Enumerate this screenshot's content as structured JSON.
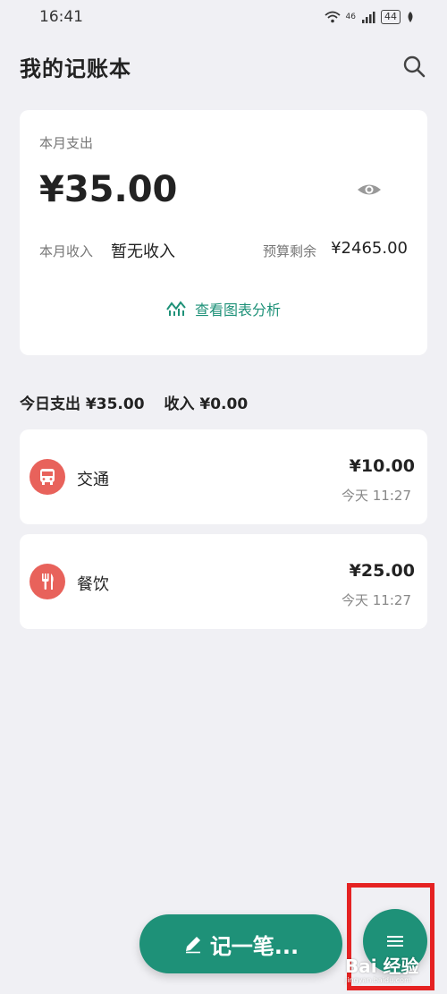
{
  "status_bar": {
    "time": "16:41",
    "signal_label": "46",
    "battery_level": "44"
  },
  "header": {
    "title": "我的记账本",
    "search_icon": "search-icon"
  },
  "summary": {
    "expense_label": "本月支出",
    "expense_amount": "¥35.00",
    "income_label": "本月收入",
    "income_value": "暂无收入",
    "budget_label": "预算剩余",
    "budget_value": "¥2465.00",
    "chart_link_label": "查看图表分析"
  },
  "today": {
    "expense_text": "今日支出 ¥35.00",
    "income_text": "收入 ¥0.00"
  },
  "transactions": [
    {
      "category": "交通",
      "amount": "¥10.00",
      "time": "今天 11:27",
      "icon": "bus-icon"
    },
    {
      "category": "餐饮",
      "amount": "¥25.00",
      "time": "今天 11:27",
      "icon": "fork-knife-icon"
    }
  ],
  "actions": {
    "record_label": "记一笔...",
    "menu_icon": "menu-icon"
  },
  "watermark": {
    "text": "Bai 经验",
    "url": "jingyan.baidu.com"
  },
  "colors": {
    "accent": "#1e9178",
    "category_icon_bg": "#e8625b",
    "highlight": "#e52222",
    "background": "#f0f0f4"
  }
}
